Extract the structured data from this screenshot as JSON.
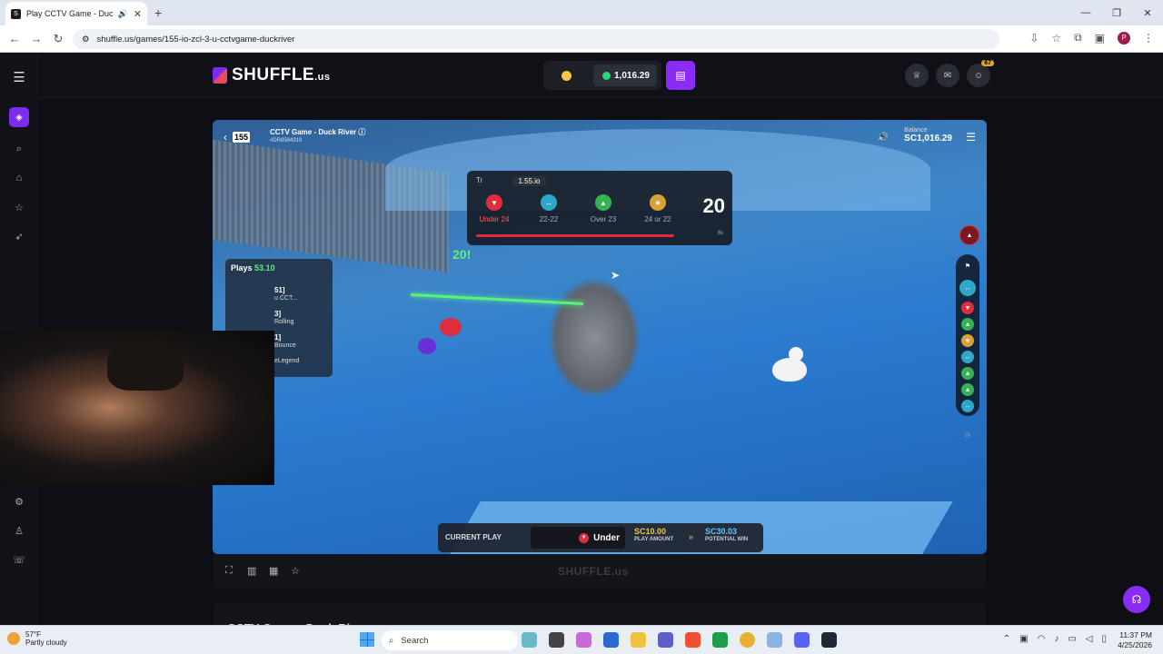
{
  "browser": {
    "tab_title": "Play CCTV Game - Duck Riv",
    "url": "shuffle.us/games/155-io-zcl-3-u-cctvgame-duckriver",
    "new_tab_label": "+"
  },
  "site": {
    "brand": "SHUFFLE",
    "brand_suffix": ".us",
    "wallet_balance": "1,016.29",
    "notification_count": "67"
  },
  "game": {
    "logo_text": "155",
    "title": "CCTV Game - Duck River",
    "id": "#DR8584319",
    "balance_label": "Balance",
    "balance_value": "SC1,016.29",
    "odds_panel": {
      "tab_left": "Tr  ",
      "tab_right": "1.55.io",
      "options": [
        {
          "label": "Under 24",
          "color": "#e02d3c"
        },
        {
          "label": "22-22",
          "color": "#2fa7c9"
        },
        {
          "label": "Over 23",
          "color": "#36b153"
        },
        {
          "label": "24 or 22",
          "color": "#d8a237"
        }
      ],
      "number": "20",
      "small": "8s"
    },
    "float_count": "20!",
    "plays": {
      "label": "Plays",
      "value": "53.10",
      "rows": [
        {
          "a": "51]",
          "b": "u CCT..."
        },
        {
          "a": "3]",
          "b": "Rolling"
        },
        {
          "a": "1]",
          "b": "Bounce"
        },
        {
          "a": "",
          "b": "eLegend"
        }
      ]
    },
    "current_play": {
      "label": "CURRENT PLAY",
      "selection": "Under",
      "amount": "SC10.00",
      "amount_label": "PLAY AMOUNT",
      "win": "SC30.03",
      "win_label": "POTENTIAL WIN"
    },
    "watermark": "SHUFFLE.us"
  },
  "below": {
    "title": "CCTV Game - Duck Riv"
  },
  "taskbar": {
    "temp": "57°F",
    "weather": "Partly cloudy",
    "search": "Search",
    "time": "11:37 PM",
    "date": "4/25/2026"
  }
}
